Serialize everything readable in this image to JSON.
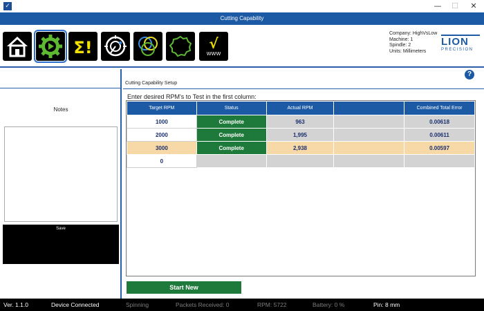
{
  "window": {
    "minimize_glyph": "—",
    "maximize_glyph": "☐",
    "close_glyph": "✕"
  },
  "header": {
    "title": "Cutting Capability"
  },
  "toolbar": {
    "tools": [
      {
        "icon": "home-icon"
      },
      {
        "icon": "play-gear-icon"
      },
      {
        "icon": "sigma-alert-icon"
      },
      {
        "icon": "spindle-icon"
      },
      {
        "icon": "rings-icon"
      },
      {
        "icon": "gear-outline-icon"
      },
      {
        "icon": "sqrt-wave-icon"
      }
    ],
    "sigma_text": "Σ!",
    "sqrt_text": "√",
    "wave_text": "WWW"
  },
  "machine": {
    "company": "Company: HighVsLow",
    "machine": "Machine: 1",
    "spindle": "Spindle: 2",
    "units": "Units: Millimeters"
  },
  "logo": {
    "main": "LION",
    "sub": "PRECISION"
  },
  "left": {
    "notes_label": "Notes",
    "save_label": "Save"
  },
  "main": {
    "help": "?",
    "setup_label": "Cutting Capability Setup",
    "instruction": "Enter desired RPM's to Test in the first column:",
    "columns": [
      "Target RPM",
      "Status",
      "Actual RPM",
      "",
      "Combined Total Error"
    ],
    "rows": [
      {
        "target": "1000",
        "status": "Complete",
        "actual": "963",
        "extra": "",
        "error": "0.00618"
      },
      {
        "target": "2000",
        "status": "Complete",
        "actual": "1,995",
        "extra": "",
        "error": "0.00611"
      },
      {
        "target": "3000",
        "status": "Complete",
        "actual": "2,938",
        "extra": "",
        "error": "0.00597"
      },
      {
        "target": "0",
        "status": "",
        "actual": "",
        "extra": "",
        "error": ""
      }
    ],
    "start_label": "Start New"
  },
  "statusbar": {
    "version": "Ver. 1.1.0",
    "device": "Device Connected",
    "spinning": "Spinning",
    "packets": "Packets Received:  0",
    "rpm": "RPM:  5722",
    "battery": "Battery:  0  %",
    "pin": "Pin: 8 mm"
  },
  "colors": {
    "brand_blue": "#1c5aa5",
    "complete_green": "#1e7a3a",
    "selected_row": "#f7d9a8"
  }
}
